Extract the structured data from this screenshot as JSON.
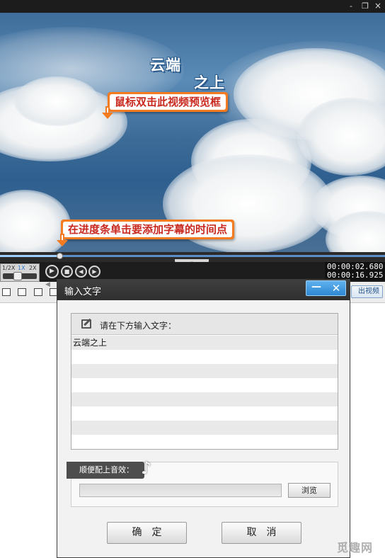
{
  "window": {
    "min_glyph": "-",
    "max_glyph": "❐",
    "close_glyph": "×"
  },
  "preview": {
    "subtitle_line1": "云端",
    "subtitle_line2": "之上",
    "callout_preview": "鼠标双击此视频预览框",
    "callout_timeline": "在进度条单击要添加字幕的时间点"
  },
  "timeline": {
    "progress_fraction": 0.157
  },
  "player": {
    "speed_options": [
      "1/2X",
      "1X",
      "2X"
    ],
    "selected_speed": "1X",
    "buttons": {
      "play": "▶",
      "stop": "■",
      "prev": "◀",
      "next": "▶"
    },
    "current_time": "00:00:02.680",
    "total_time": "00:00:16.925"
  },
  "toolbar": {
    "export_label": "出视频"
  },
  "dialog": {
    "title": "输入文字",
    "min_glyph": "—",
    "close_glyph": "✕",
    "text_panel_label": "请在下方输入文字：",
    "text_lines": [
      "云端之上",
      "",
      "",
      "",
      "",
      "",
      "",
      ""
    ],
    "sound_label": "顺便配上音效：",
    "note_glyph": "♪",
    "file_value": "",
    "browse_label": "浏览",
    "ok_label": "确定",
    "cancel_label": "取消"
  },
  "watermark": "觅趣网"
}
